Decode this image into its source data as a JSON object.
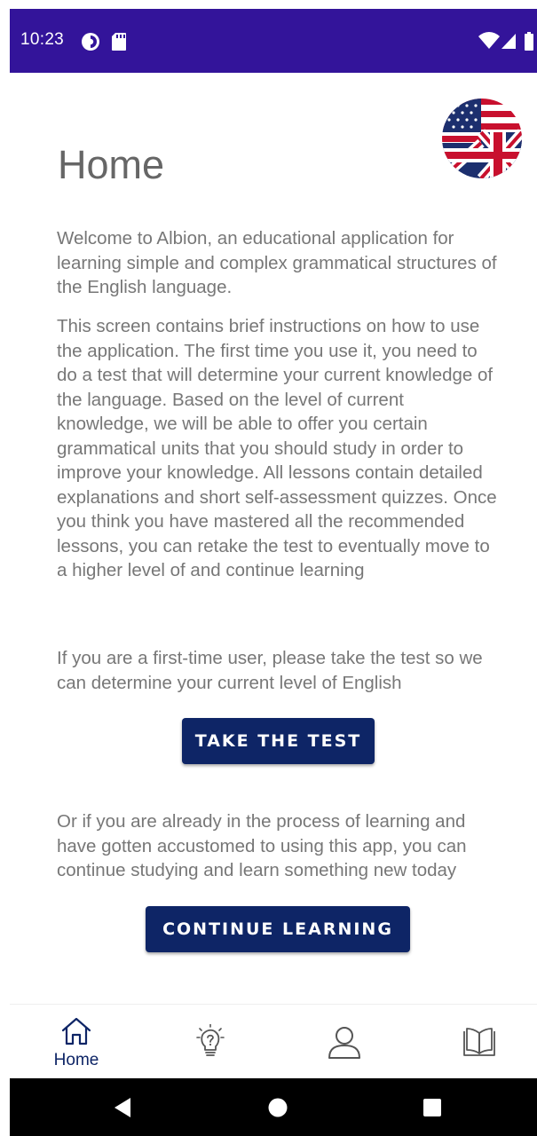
{
  "status_bar": {
    "time": "10:23",
    "icons": [
      "data-saver-icon",
      "sd-card-icon",
      "wifi-icon",
      "signal-icon",
      "battery-icon"
    ],
    "background": "#33149a"
  },
  "header": {
    "title": "Home",
    "language_flag": "uk-us-flag-icon"
  },
  "main": {
    "intro": "Welcome to Albion, an educational application for learning simple and complex grammatical structures of the English language.",
    "instructions": "This screen contains brief instructions on how to use the application. The first time you use it, you need to do a test that will determine your current knowledge of the language. Based on the level of current knowledge, we will be able to offer you certain grammatical units that you should study in order to improve your knowledge. All lessons contain detailed explanations and short self-assessment quizzes. Once you think you have mastered all the recommended lessons, you can retake the test to eventually move to a higher level of and continue learning",
    "first_time_text": "If you are a first-time user, please take the test so we can determine your current level of English",
    "take_test_label": "TAKE THE TEST",
    "continue_text": "Or if you are already in the process of learning and have gotten accustomed to using this app, you can continue studying and learn something new today",
    "continue_label": "CONTINUE LEARNING",
    "button_color": "#0e2566"
  },
  "bottom_nav": {
    "items": [
      {
        "icon": "home-icon",
        "label": "Home",
        "active": true
      },
      {
        "icon": "lightbulb-icon",
        "label": ""
      },
      {
        "icon": "user-icon",
        "label": ""
      },
      {
        "icon": "book-icon",
        "label": ""
      }
    ]
  },
  "system_nav": {
    "icons": [
      "back-icon",
      "home-circle-icon",
      "recents-icon"
    ]
  }
}
